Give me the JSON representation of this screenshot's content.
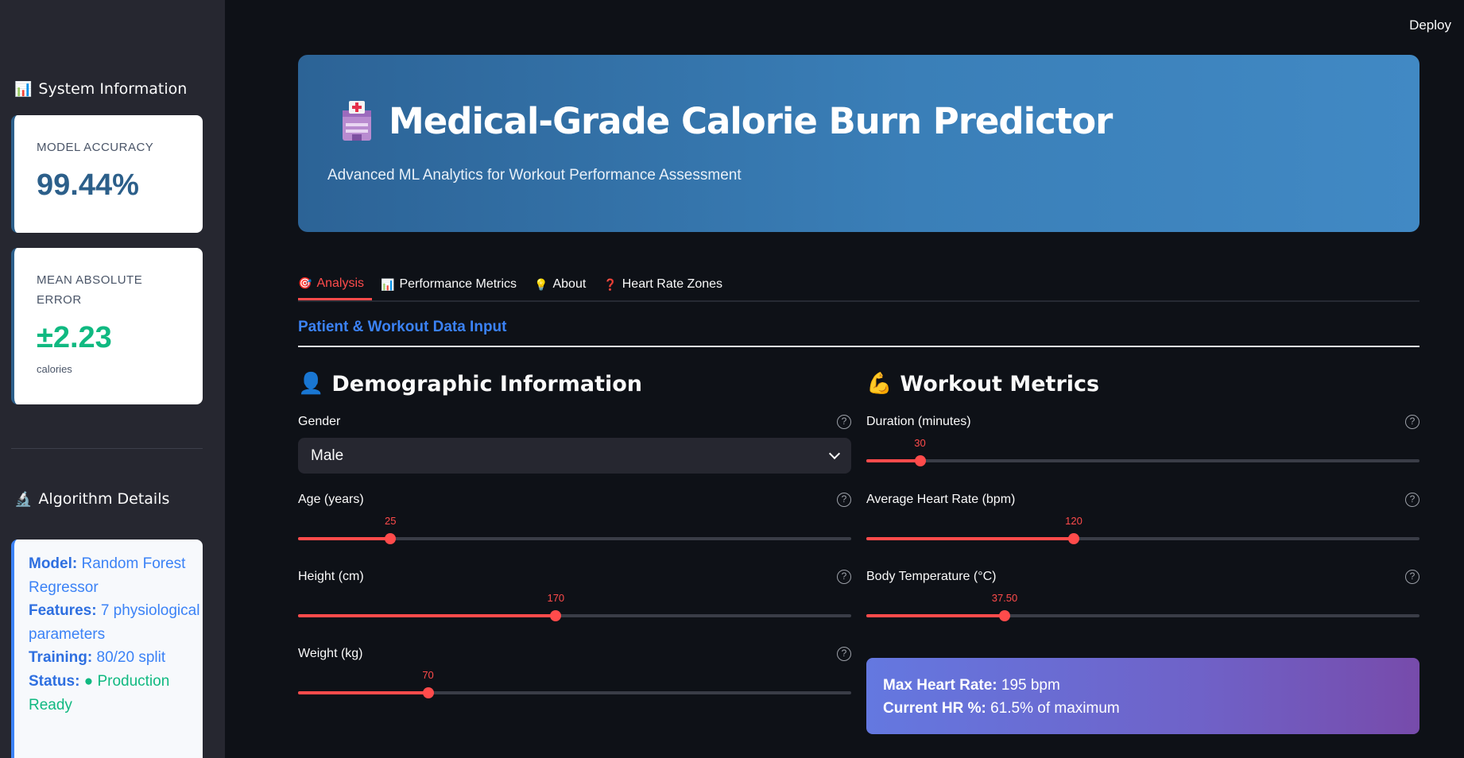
{
  "app": {
    "deploy_label": "Deploy"
  },
  "sidebar": {
    "system_heading": "System Information",
    "system_icon": "bar-chart-icon",
    "accuracy": {
      "label": "MODEL ACCURACY",
      "value": "99.44%"
    },
    "mae": {
      "label": "MEAN ABSOLUTE ERROR",
      "value": "±2.23",
      "unit": "calories"
    },
    "algo_heading": "Algorithm Details",
    "algo_icon": "microscope-icon",
    "algo": {
      "model_key": "Model:",
      "model_val": "Random Forest Regressor",
      "features_key": "Features:",
      "features_val": "7 physiological parameters",
      "training_key": "Training:",
      "training_val": "80/20 split",
      "status_key": "Status:",
      "status_val": "● Production Ready"
    }
  },
  "hero": {
    "icon": "hospital-icon",
    "title": "Medical-Grade Calorie Burn Predictor",
    "subtitle": "Advanced ML Analytics for Workout Performance Assessment"
  },
  "tabs": [
    {
      "label": "Analysis",
      "icon": "🎯",
      "active": true
    },
    {
      "label": "Performance Metrics",
      "icon": "📊",
      "active": false
    },
    {
      "label": "About",
      "icon": "💡",
      "active": false
    },
    {
      "label": "Heart Rate Zones",
      "icon": "❓",
      "active": false
    }
  ],
  "section_title": "Patient & Workout Data Input",
  "demographic": {
    "heading": "Demographic Information",
    "icon": "👤",
    "gender": {
      "label": "Gender",
      "value": "Male"
    },
    "age": {
      "label": "Age (years)",
      "value": "25",
      "fraction": 0.167
    },
    "height": {
      "label": "Height (cm)",
      "value": "170",
      "fraction": 0.466
    },
    "weight": {
      "label": "Weight (kg)",
      "value": "70",
      "fraction": 0.235
    }
  },
  "workout": {
    "heading": "Workout Metrics",
    "icon": "💪",
    "duration": {
      "label": "Duration (minutes)",
      "value": "30",
      "fraction": 0.097
    },
    "heart_rate": {
      "label": "Average Heart Rate (bpm)",
      "value": "120",
      "fraction": 0.375
    },
    "temperature": {
      "label": "Body Temperature (°C)",
      "value": "37.50",
      "fraction": 0.25
    }
  },
  "hr_summary": {
    "max_key": "Max Heart Rate:",
    "max_val": "195 bpm",
    "current_key": "Current HR %:",
    "current_val": "61.5% of maximum"
  },
  "colors": {
    "accent": "#ff4b4b",
    "primary_blue": "#3b82f6",
    "success": "#10b981",
    "hero_start": "#2c6396",
    "hero_end": "#4189c4"
  }
}
